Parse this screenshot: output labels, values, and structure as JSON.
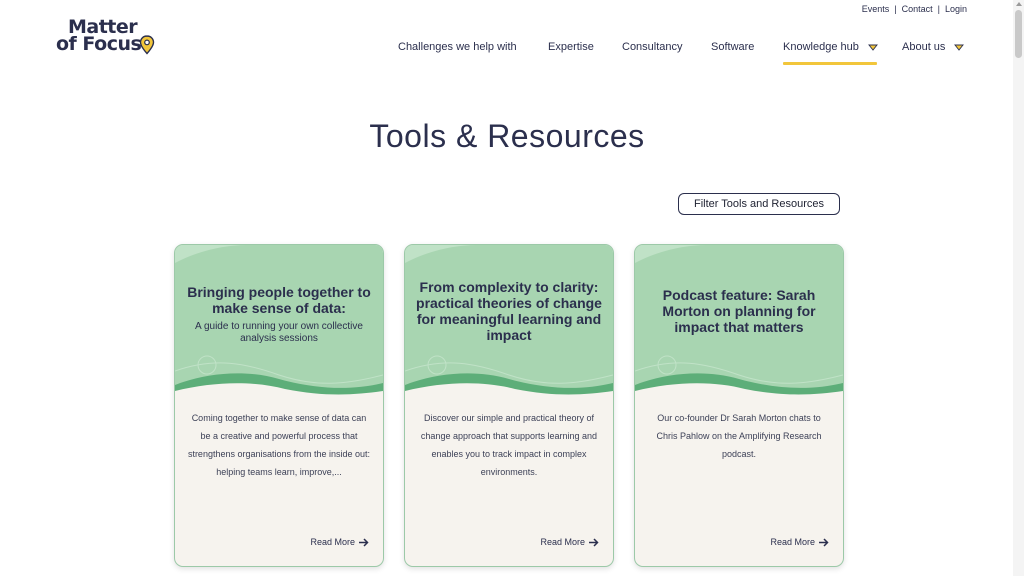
{
  "utility_nav": [
    "Events",
    "Contact",
    "Login"
  ],
  "logo": {
    "line1": "Matter",
    "line2": "of Focus"
  },
  "nav": {
    "items": [
      {
        "label": "Challenges we help with"
      },
      {
        "label": "Expertise"
      },
      {
        "label": "Consultancy"
      },
      {
        "label": "Software"
      },
      {
        "label": "Knowledge hub",
        "dropdown": true,
        "active": true
      },
      {
        "label": "About us",
        "dropdown": true
      }
    ]
  },
  "page": {
    "title": "Tools & Resources",
    "filter_button": "Filter Tools and Resources"
  },
  "cards": [
    {
      "title": "Bringing people together to make sense of data:",
      "subtitle": "A guide to running your own collective analysis sessions",
      "excerpt": "Coming together to make sense of data can be a creative and powerful process that strengthens organisations from the inside out: helping teams learn, improve,...",
      "link": "Read More"
    },
    {
      "title": "From complexity to clarity: practical theories of change for meaningful learning and impact",
      "subtitle": "",
      "excerpt": "Discover our simple and practical theory of change approach that supports learning and enables you to track impact in complex environments.",
      "link": "Read More"
    },
    {
      "title": "Podcast feature: Sarah Morton on planning for impact that matters",
      "subtitle": "",
      "excerpt": "Our co-founder Dr Sarah Morton chats to Chris Pahlow on the Amplifying Research podcast.",
      "link": "Read More"
    }
  ],
  "colors": {
    "navy": "#2b2f4d",
    "accent_yellow": "#f2c63b",
    "card_green": "#a8d5b1",
    "card_wave": "#5dae79",
    "card_body": "#f6f3ee"
  }
}
